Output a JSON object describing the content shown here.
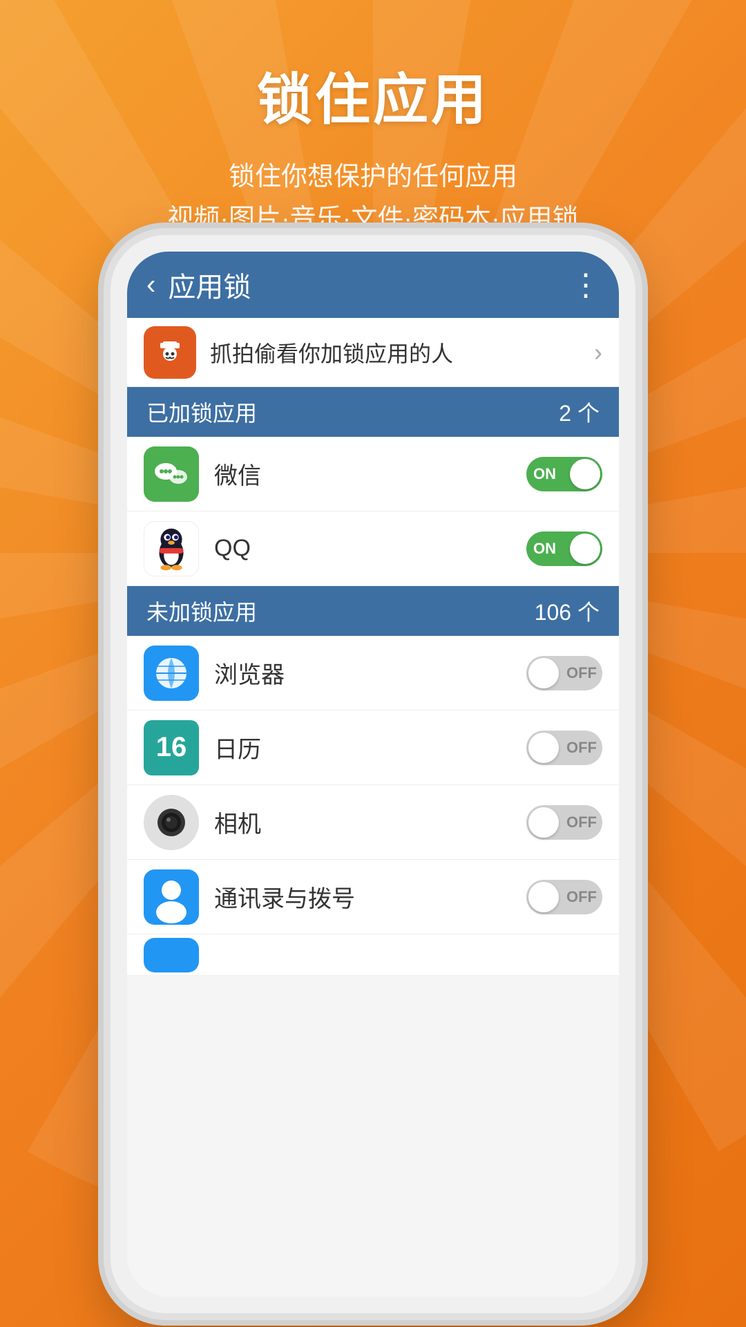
{
  "background": {
    "color": "#f5a030"
  },
  "header": {
    "title": "锁住应用",
    "subtitle1": "锁住你想保护的任何应用",
    "subtitle2": "视频·图片·音乐·文件·密码本·应用锁"
  },
  "appbar": {
    "title": "应用锁",
    "back_icon": "‹",
    "more_icon": "⋮"
  },
  "spy_row": {
    "text": "抓拍偷看你加锁应用的人",
    "chevron": "›"
  },
  "locked_section": {
    "title": "已加锁应用",
    "count": "2 个"
  },
  "unlocked_section": {
    "title": "未加锁应用",
    "count": "106 个"
  },
  "locked_apps": [
    {
      "name": "微信",
      "toggle": "ON",
      "icon_type": "wechat"
    },
    {
      "name": "QQ",
      "toggle": "ON",
      "icon_type": "qq"
    }
  ],
  "unlocked_apps": [
    {
      "name": "浏览器",
      "toggle": "OFF",
      "icon_type": "browser"
    },
    {
      "name": "日历",
      "toggle": "OFF",
      "icon_type": "calendar",
      "icon_text": "16"
    },
    {
      "name": "相机",
      "toggle": "OFF",
      "icon_type": "camera"
    },
    {
      "name": "通讯录与拨号",
      "toggle": "OFF",
      "icon_type": "contacts"
    }
  ]
}
